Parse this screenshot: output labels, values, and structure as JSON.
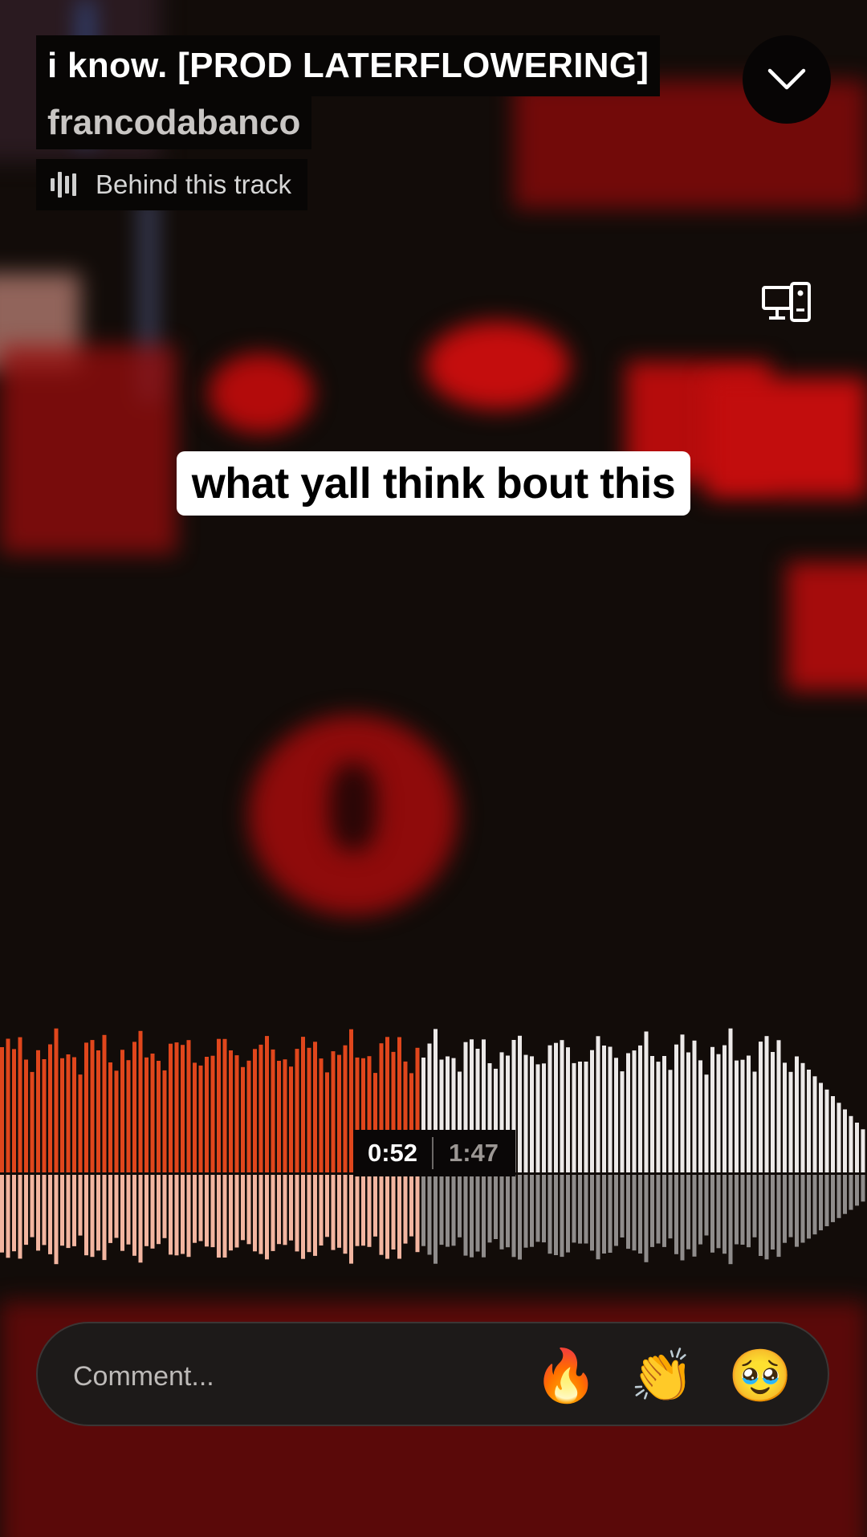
{
  "track": {
    "title": "i know. [PROD LATERFLOWERING]",
    "artist": "francodabanco",
    "behind_label": "Behind this track"
  },
  "caption": "what yall think bout this",
  "player": {
    "current_time": "0:52",
    "total_time": "1:47",
    "progress": 0.486
  },
  "comment": {
    "placeholder": "Comment...",
    "reactions": [
      "🔥",
      "👏",
      "🥹"
    ]
  },
  "colors": {
    "played": "#e0461c",
    "played_reflection": "#f2b5a0",
    "unplayed": "#ece9e8",
    "unplayed_reflection": "#8f8c8b"
  },
  "icons": [
    "chevron-down-icon",
    "devices-icon",
    "waveform-icon"
  ]
}
